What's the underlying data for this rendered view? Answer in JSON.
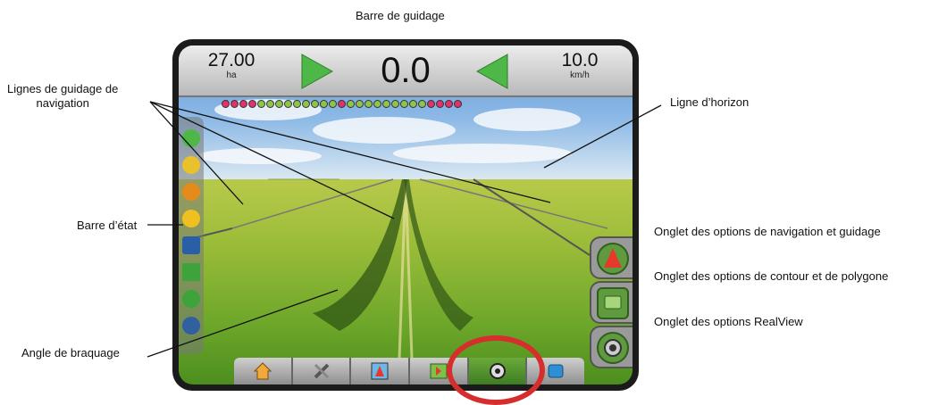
{
  "callouts": {
    "guidance_bar": "Barre de guidage",
    "nav_lines": "Lignes de guidage de\nnavigation",
    "horizon": "Ligne d’horizon",
    "status_bar": "Barre d’état",
    "nav_tab": "Onglet des options de navigation et guidage",
    "contour_tab": "Onglet des options de contour et de polygone",
    "realview_tab": "Onglet des options RealView",
    "steering": "Angle de braquage"
  },
  "screen": {
    "area_value": "27.00",
    "area_unit": "ha",
    "xtrack_value": "0.0",
    "speed_value": "10.0",
    "speed_unit": "km/h"
  },
  "lightbar": {
    "count": 27,
    "colors": [
      "#e0336b",
      "#8fc44a"
    ]
  },
  "status_icons": [
    "green-flag-icon",
    "boom-icon",
    "gnss-icon",
    "radiation-icon",
    "sensor-icon",
    "tree-icon",
    "drop-icon",
    "machine-icon"
  ],
  "right_tabs": [
    "nav-guidance-icon",
    "contour-polygon-icon",
    "realview-camera-icon"
  ],
  "bottom_tabs": [
    "home-icon",
    "tools-icon",
    "vehicle-view-icon",
    "map-view-icon",
    "camera-icon",
    "info-icon"
  ]
}
